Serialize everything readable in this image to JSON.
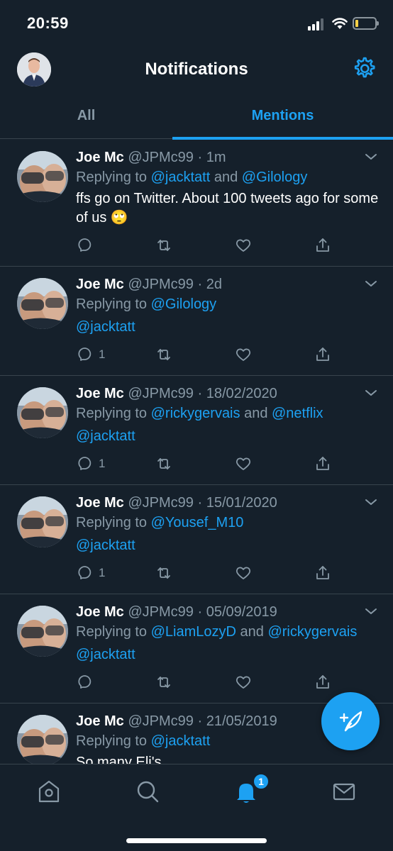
{
  "status_bar": {
    "time": "20:59"
  },
  "header": {
    "title": "Notifications",
    "avatar_icon": "profile-avatar",
    "settings_icon": "gear-icon"
  },
  "tabs": [
    {
      "label": "All",
      "active": false
    },
    {
      "label": "Mentions",
      "active": true
    }
  ],
  "tweets": [
    {
      "name": "Joe Mc",
      "meta": "@JPMc99 · 1m",
      "reply_prefix": "Replying to ",
      "reply_a": "@jacktatt",
      "reply_mid": " and ",
      "reply_b": "@Gilology",
      "text": "ffs go on Twitter. About 100 tweets ago for some of us 🙄",
      "text_is_link": false,
      "reply_count": ""
    },
    {
      "name": "Joe Mc",
      "meta": "@JPMc99 · 2d",
      "reply_prefix": "Replying to ",
      "reply_a": "@Gilology",
      "reply_mid": "",
      "reply_b": "",
      "text": "@jacktatt",
      "text_is_link": true,
      "reply_count": "1"
    },
    {
      "name": "Joe Mc",
      "meta": "@JPMc99 · 18/02/2020",
      "reply_prefix": "Replying to ",
      "reply_a": "@rickygervais",
      "reply_mid": " and ",
      "reply_b": "@netflix",
      "text": "@jacktatt",
      "text_is_link": true,
      "reply_count": "1"
    },
    {
      "name": "Joe Mc",
      "meta": "@JPMc99 · 15/01/2020",
      "reply_prefix": "Replying to ",
      "reply_a": "@Yousef_M10",
      "reply_mid": "",
      "reply_b": "",
      "text": "@jacktatt",
      "text_is_link": true,
      "reply_count": "1"
    },
    {
      "name": "Joe Mc",
      "meta": "@JPMc99 · 05/09/2019",
      "reply_prefix": "Replying to ",
      "reply_a": "@LiamLozyD",
      "reply_mid": " and ",
      "reply_b": "@rickygervais",
      "text": "@jacktatt",
      "text_is_link": true,
      "reply_count": ""
    },
    {
      "name": "Joe Mc",
      "meta": "@JPMc99 · 21/05/2019",
      "reply_prefix": "Replying to ",
      "reply_a": "@jacktatt",
      "reply_mid": "",
      "reply_b": "",
      "text": "So many Eli's",
      "text_is_link": false,
      "reply_count": ""
    }
  ],
  "compose_icon": "compose-tweet-icon",
  "bottom_nav": {
    "items": [
      "home-icon",
      "search-icon",
      "notifications-bell-icon",
      "messages-icon"
    ],
    "notification_badge": "1"
  },
  "colors": {
    "background": "#15202b",
    "accent": "#1da1f2",
    "secondary_text": "#8899a6",
    "divider": "#38444d"
  }
}
